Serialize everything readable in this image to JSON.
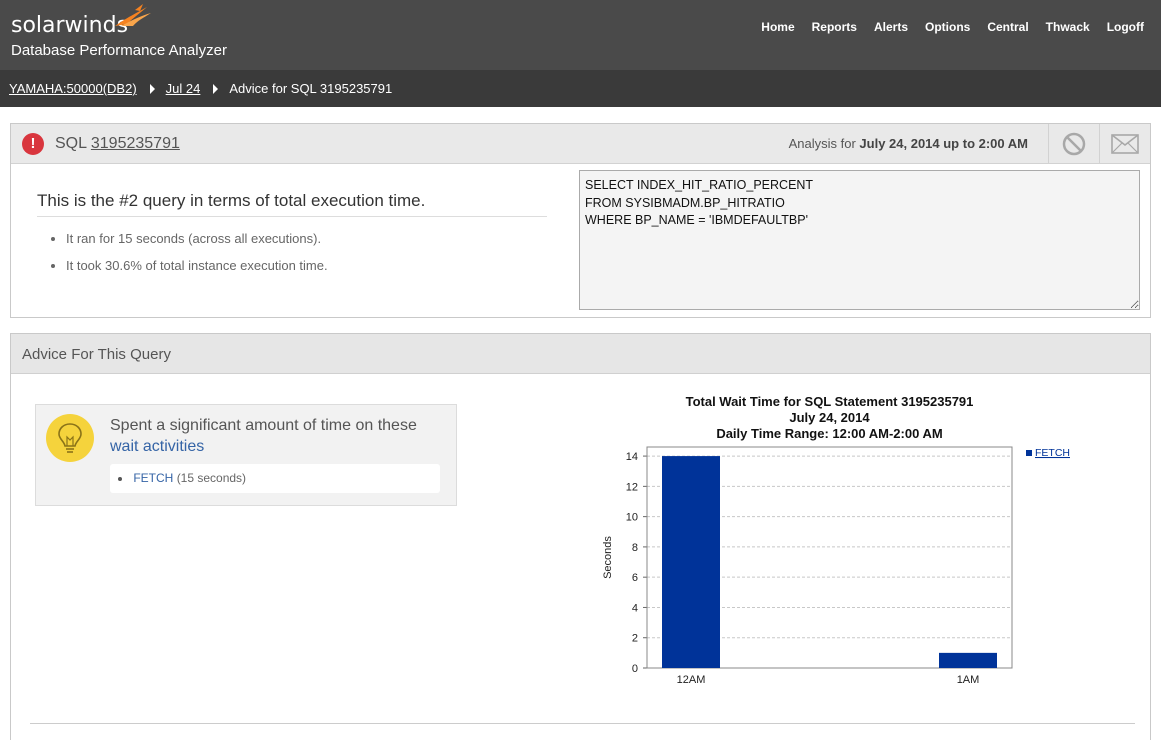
{
  "app": {
    "brand": "solarwinds",
    "product": "Database Performance Analyzer"
  },
  "nav": [
    "Home",
    "Reports",
    "Alerts",
    "Options",
    "Central",
    "Thwack",
    "Logoff"
  ],
  "breadcrumb": {
    "instance": "YAMAHA:50000(DB2)",
    "date": "Jul 24",
    "current": "Advice for SQL 3195235791"
  },
  "sql_panel": {
    "sql_prefix": "SQL",
    "sql_id": "3195235791",
    "analysis_prefix": "Analysis for",
    "analysis_range": "July 24, 2014 up to 2:00 AM",
    "summary_title": "This is the #2 query in terms of total execution time.",
    "bullets": [
      "It ran for 15 seconds (across all executions).",
      "It took 30.6% of total instance execution time."
    ],
    "sql_text": "SELECT INDEX_HIT_RATIO_PERCENT\nFROM SYSIBMADM.BP_HITRATIO\nWHERE BP_NAME = 'IBMDEFAULTBP'"
  },
  "advice_panel": {
    "title": "Advice For This Query",
    "card_text": "Spent a significant amount of time on these",
    "card_link": "wait activities",
    "wait_name": "FETCH",
    "wait_detail": "(15 seconds)"
  },
  "chart_data": {
    "type": "bar",
    "title": [
      "Total Wait Time for SQL Statement 3195235791",
      "July 24, 2014",
      "Daily Time Range: 12:00 AM-2:00 AM"
    ],
    "categories": [
      "12AM",
      "1AM"
    ],
    "series": [
      {
        "name": "FETCH",
        "values": [
          14.0,
          1.0
        ],
        "color": "#003399"
      }
    ],
    "ylabel": "Seconds",
    "xlabel": "",
    "ylim": [
      0,
      14.6
    ],
    "yticks": [
      0,
      2,
      4,
      6,
      8,
      10,
      12,
      14
    ],
    "grid": true,
    "legend": "right"
  }
}
